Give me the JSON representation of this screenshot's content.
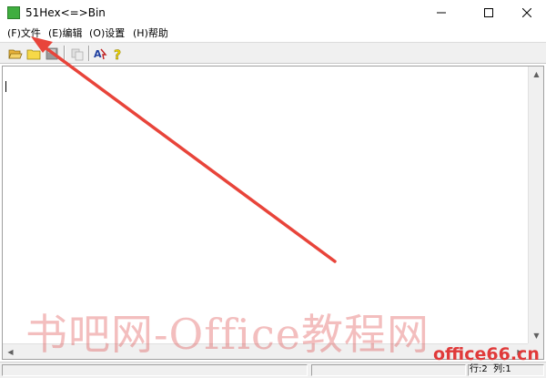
{
  "window": {
    "title": "51Hex<=>Bin"
  },
  "menu": {
    "items": [
      "(F)文件",
      "(E)编辑",
      "(O)设置",
      "(H)帮助"
    ]
  },
  "toolbar": {
    "icons": [
      "open-folder-icon",
      "new-folder-icon",
      "save-icon",
      "copy-icon",
      "convert-icon",
      "help-icon"
    ]
  },
  "status": {
    "row": "行:2",
    "col": "列:1"
  },
  "watermark": {
    "text": "书吧网-Office教程网",
    "site": "office66.cn"
  },
  "colors": {
    "accent_arrow": "#e8443a",
    "app_icon": "#3fae3f"
  }
}
